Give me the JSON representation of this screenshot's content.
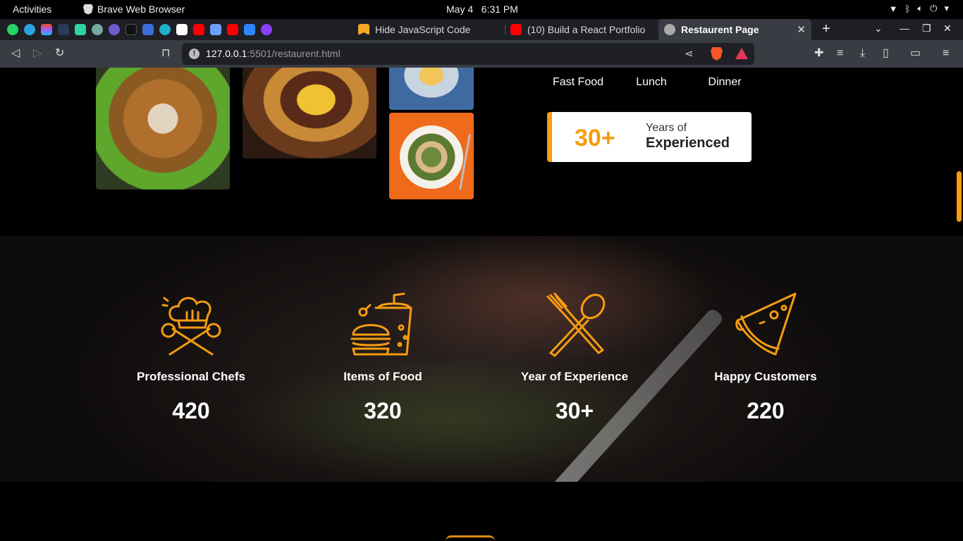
{
  "system_bar": {
    "activities": "Activities",
    "app_name": "Brave Web Browser",
    "date": "May 4",
    "time": "6:31 PM"
  },
  "tabs": [
    {
      "title": "Hide JavaScript Code",
      "active": false
    },
    {
      "title": "(10) Build a React Portfolio",
      "active": false
    },
    {
      "title": "Restaurent Page",
      "active": true
    }
  ],
  "pinned_icons": [
    "whatsapp-icon",
    "telegram-icon",
    "figma-icon",
    "extension-icon",
    "app-icon",
    "chatgpt-icon",
    "app-icon",
    "app-icon",
    "docs-icon",
    "play-icon",
    "app-icon",
    "youtube-icon",
    "app-icon",
    "youtube-icon",
    "app-icon",
    "app-icon"
  ],
  "address": {
    "host": "127.0.0.1",
    "path": ":5501/restaurent.html"
  },
  "categories": [
    "Fast Food",
    "Lunch",
    "Dinner"
  ],
  "experience_card": {
    "value": "30+",
    "line1": "Years of",
    "line2": "Experienced"
  },
  "stats": [
    {
      "icon": "chef-hat-icon",
      "label": "Professional Chefs",
      "value": "420"
    },
    {
      "icon": "burger-drink-icon",
      "label": "Items of Food",
      "value": "320"
    },
    {
      "icon": "fork-spoon-icon",
      "label": "Year of Experience",
      "value": "30+"
    },
    {
      "icon": "pizza-slice-icon",
      "label": "Happy Customers",
      "value": "220"
    }
  ],
  "colors": {
    "accent": "#f59c11",
    "page_bg": "#000000",
    "toolbar_bg": "#3a3c44"
  }
}
